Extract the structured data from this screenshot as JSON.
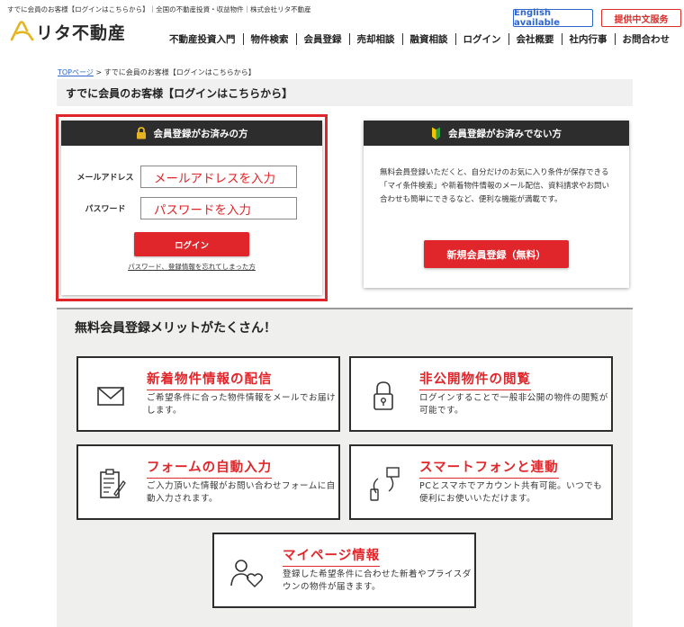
{
  "header": {
    "topline": "すでに会員のお客様【ログインはこちらから】｜全国の不動産投資・収益物件｜株式会社リタ不動産",
    "logo_text": "リタ不動産",
    "english_btn": "English available",
    "chinese_btn": "提供中文服务",
    "nav": [
      "不動産投資入門",
      "物件検索",
      "会員登録",
      "売却相談",
      "融資相談",
      "ログイン",
      "会社概要",
      "社内行事",
      "お問合わせ"
    ]
  },
  "breadcrumb": {
    "top": "TOPページ",
    "sep": " > ",
    "current": "すでに会員のお客様【ログインはこちらから】"
  },
  "page_title": "すでに会員のお客様【ログインはこちらから】",
  "login": {
    "heading": "会員登録がお済みの方",
    "email_label": "メールアドレス",
    "email_value": "メールアドレスを入力",
    "password_label": "パスワード",
    "password_value": "パスワードを入力",
    "login_button": "ログイン",
    "forgot_link": "パスワード、登録情報を忘れてしまった方"
  },
  "register": {
    "heading": "会員登録がお済みでない方",
    "text": "無料会員登録いただくと、自分だけのお気に入り条件が保存できる「マイ条件検索」や新着物件情報のメール配信、資料請求やお問い合わせも簡単にできるなど、便利な機能が満載です。",
    "button": "新規会員登録（無料）"
  },
  "merits": {
    "title": "無料会員登録メリットがたくさん！",
    "cards": [
      {
        "title": "新着物件情報の配信",
        "desc": "ご希望条件に合った物件情報をメールでお届けします。",
        "icon": "mail-icon"
      },
      {
        "title": "非公開物件の閲覧",
        "desc": "ログインすることで一般非公開の物件の閲覧が可能です。",
        "icon": "lock-icon"
      },
      {
        "title": "フォームの自動入力",
        "desc": "ご入力頂いた情報がお問い合わせフォームに自動入力されます。",
        "icon": "form-icon"
      },
      {
        "title": "スマートフォンと連動",
        "desc": "PCとスマホでアカウント共有可能。いつでも便利にお使いいただけます。",
        "icon": "smartphone-icon"
      },
      {
        "title": "マイページ情報",
        "desc": "登録した希望条件に合わせた新着やプライスダウンの物件が届きます。",
        "icon": "person-heart-icon"
      }
    ]
  },
  "colors": {
    "accent_red": "#e0262a",
    "english_blue": "#2f66c9",
    "header_dark": "#2d2d2d"
  }
}
